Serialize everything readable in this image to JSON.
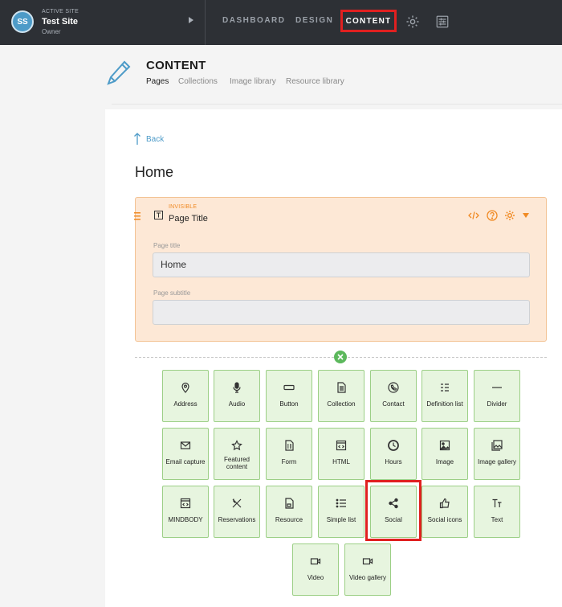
{
  "site": {
    "label": "ACTIVE SITE",
    "name": "Test Site",
    "role": "Owner",
    "initials": "SS"
  },
  "nav": {
    "dashboard": "DASHBOARD",
    "design": "DESIGN",
    "content": "CONTENT"
  },
  "header": {
    "title": "CONTENT",
    "tabs": [
      "Pages",
      "Collections",
      "Image library",
      "Resource library"
    ]
  },
  "editor": {
    "back": "Back",
    "page_heading": "Home",
    "block": {
      "status": "INVISIBLE",
      "title": "Page Title",
      "fields": [
        {
          "label": "Page title",
          "value": "Home"
        },
        {
          "label": "Page subtitle",
          "value": ""
        }
      ]
    }
  },
  "tiles": [
    {
      "label": "Address",
      "icon": "map-pin-icon"
    },
    {
      "label": "Audio",
      "icon": "microphone-icon"
    },
    {
      "label": "Button",
      "icon": "button-icon"
    },
    {
      "label": "Collection",
      "icon": "document-icon"
    },
    {
      "label": "Contact",
      "icon": "phone-icon"
    },
    {
      "label": "Definition list",
      "icon": "definition-list-icon"
    },
    {
      "label": "Divider",
      "icon": "divider-line-icon"
    },
    {
      "label": "Email capture",
      "icon": "envelope-icon"
    },
    {
      "label": "Featured content",
      "icon": "star-icon"
    },
    {
      "label": "Form",
      "icon": "form-icon"
    },
    {
      "label": "HTML",
      "icon": "html-code-icon"
    },
    {
      "label": "Hours",
      "icon": "clock-icon"
    },
    {
      "label": "Image",
      "icon": "image-icon"
    },
    {
      "label": "Image gallery",
      "icon": "image-gallery-icon"
    },
    {
      "label": "MINDBODY",
      "icon": "mindbody-icon"
    },
    {
      "label": "Reservations",
      "icon": "fork-knife-icon"
    },
    {
      "label": "Resource",
      "icon": "resource-file-icon"
    },
    {
      "label": "Simple list",
      "icon": "list-icon"
    },
    {
      "label": "Social",
      "icon": "share-icon"
    },
    {
      "label": "Social icons",
      "icon": "thumbs-up-icon"
    },
    {
      "label": "Text",
      "icon": "text-icon"
    },
    {
      "label": "Video",
      "icon": "video-camera-icon"
    },
    {
      "label": "Video gallery",
      "icon": "video-gallery-icon"
    }
  ],
  "colors": {
    "accent_blue": "#4d9bc8",
    "block_orange": "#f08a24",
    "tile_green": "#e7f5df",
    "highlight_red": "#e02020",
    "topbar": "#2d3035"
  }
}
